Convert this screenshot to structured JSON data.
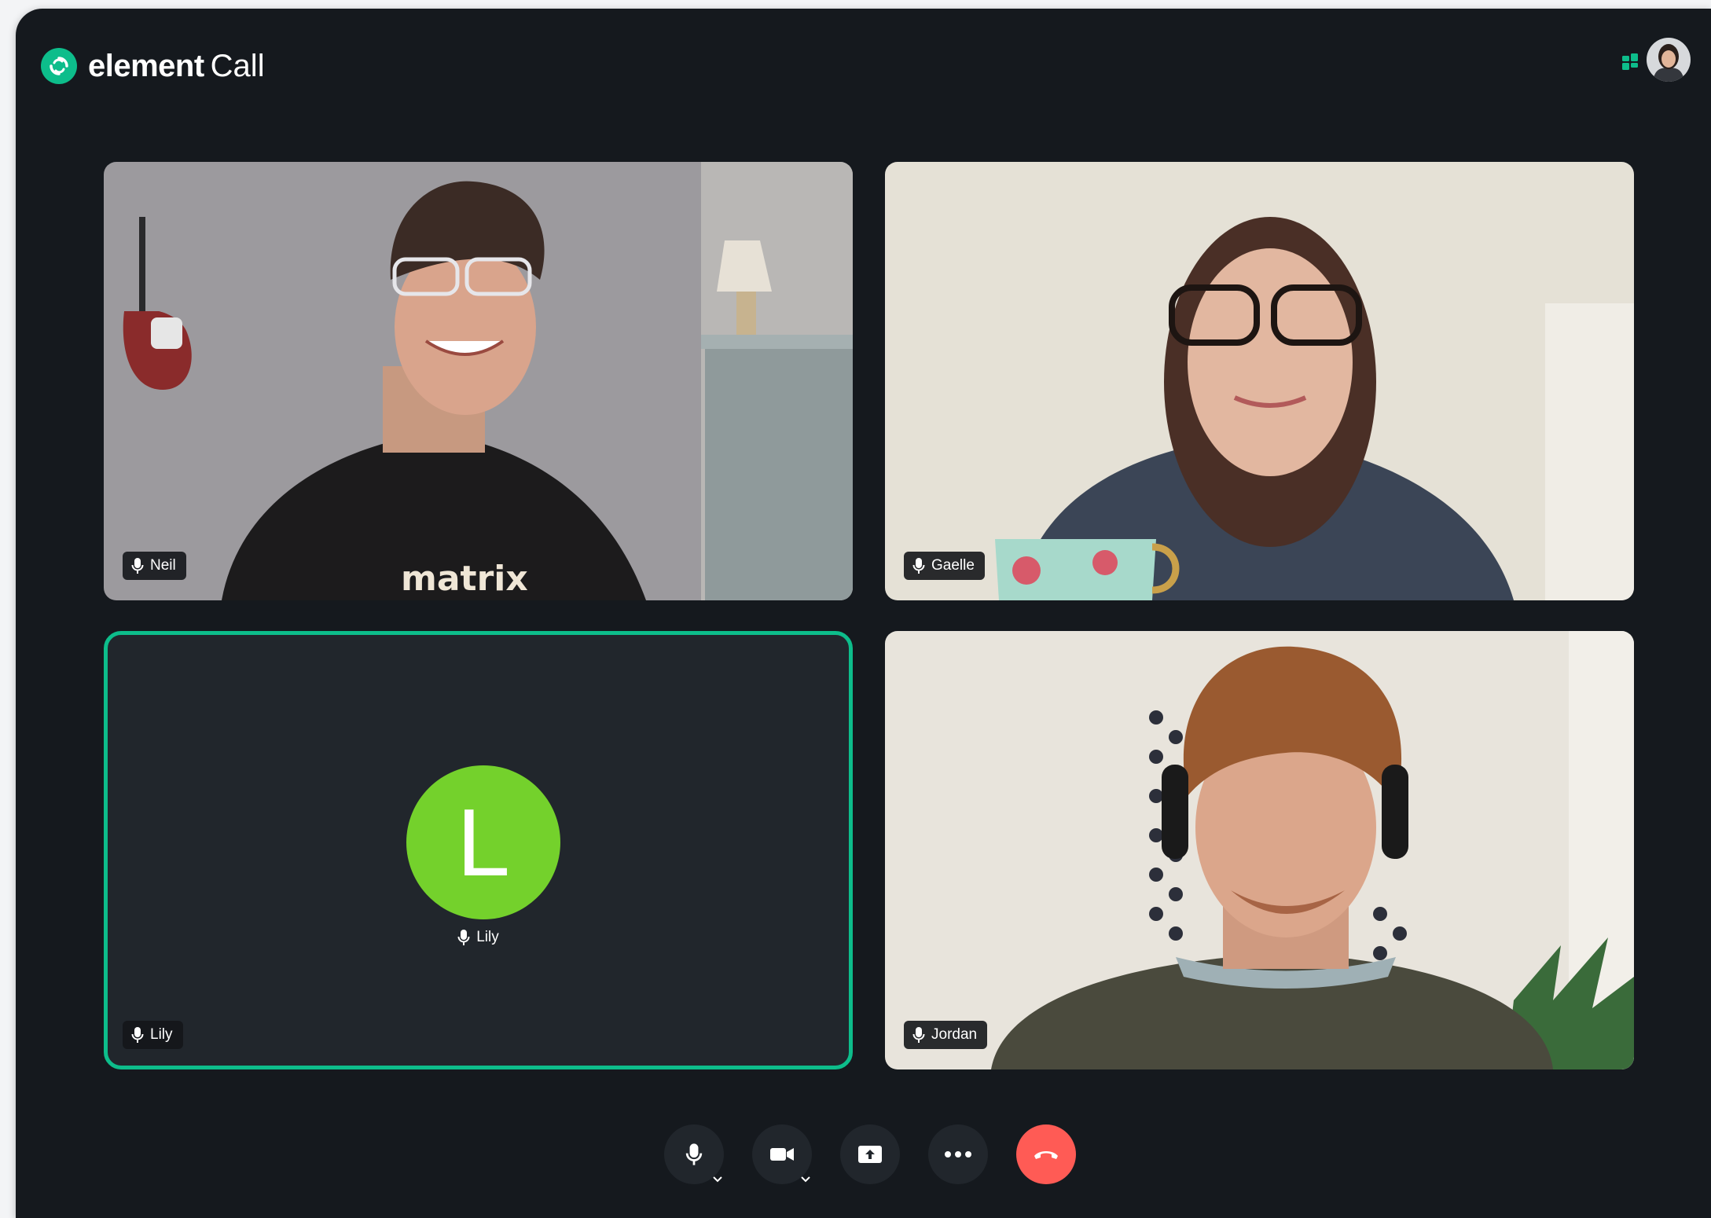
{
  "app": {
    "brand_word": "element",
    "brand_product": "Call"
  },
  "header": {
    "layout_icon": "grid-layout-icon",
    "user_avatar": "user-avatar"
  },
  "participants": [
    {
      "name": "Neil",
      "video": "on",
      "mic_icon": "microphone-icon"
    },
    {
      "name": "Gaelle",
      "video": "on",
      "mic_icon": "microphone-icon"
    },
    {
      "name": "Lily",
      "video": "off",
      "avatar_initial": "L",
      "speaking": true,
      "mic_icon": "microphone-icon"
    },
    {
      "name": "Jordan",
      "video": "on",
      "mic_icon": "microphone-icon"
    }
  ],
  "controls": [
    {
      "icon": "microphone-icon",
      "has_menu": true
    },
    {
      "icon": "video-camera-icon",
      "has_menu": true
    },
    {
      "icon": "screen-share-icon",
      "has_menu": false
    },
    {
      "icon": "more-options-icon",
      "has_menu": false
    },
    {
      "icon": "hang-up-icon",
      "has_menu": false
    }
  ],
  "colors": {
    "accent": "#0dbd8b",
    "background": "#15191e",
    "tile": "#21262c",
    "avatar": "#74d12c",
    "hangup": "#ff5b55"
  }
}
